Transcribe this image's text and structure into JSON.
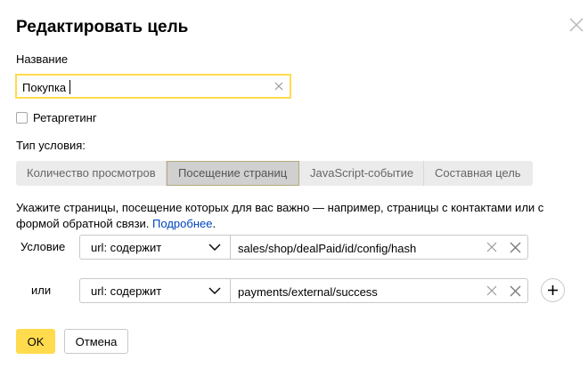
{
  "dialog": {
    "title": "Редактировать цель",
    "close_icon": "close-icon"
  },
  "name": {
    "label": "Название",
    "value": "Покупка"
  },
  "retargeting": {
    "label": "Ретаргетинг",
    "checked": false
  },
  "condition_type": {
    "label": "Тип условия:",
    "options": [
      "Количество просмотров",
      "Посещение страниц",
      "JavaScript-событие",
      "Составная цель"
    ],
    "selected": "Посещение страниц"
  },
  "description": {
    "text": "Укажите страницы, посещение которых для вас важно — например, страницы с контактами или с формой обратной связи.",
    "link": "Подробнее"
  },
  "conditions": [
    {
      "label": "Условие",
      "operator": "url: содержит",
      "value": "sales/shop/dealPaid/id/config/hash"
    },
    {
      "label": "или",
      "operator": "url: содержит",
      "value": "payments/external/success"
    }
  ],
  "actions": {
    "ok_label": "OK",
    "cancel_label": "Отмена"
  },
  "colors": {
    "accent": "#ffdb4d",
    "link": "#0044bb"
  }
}
